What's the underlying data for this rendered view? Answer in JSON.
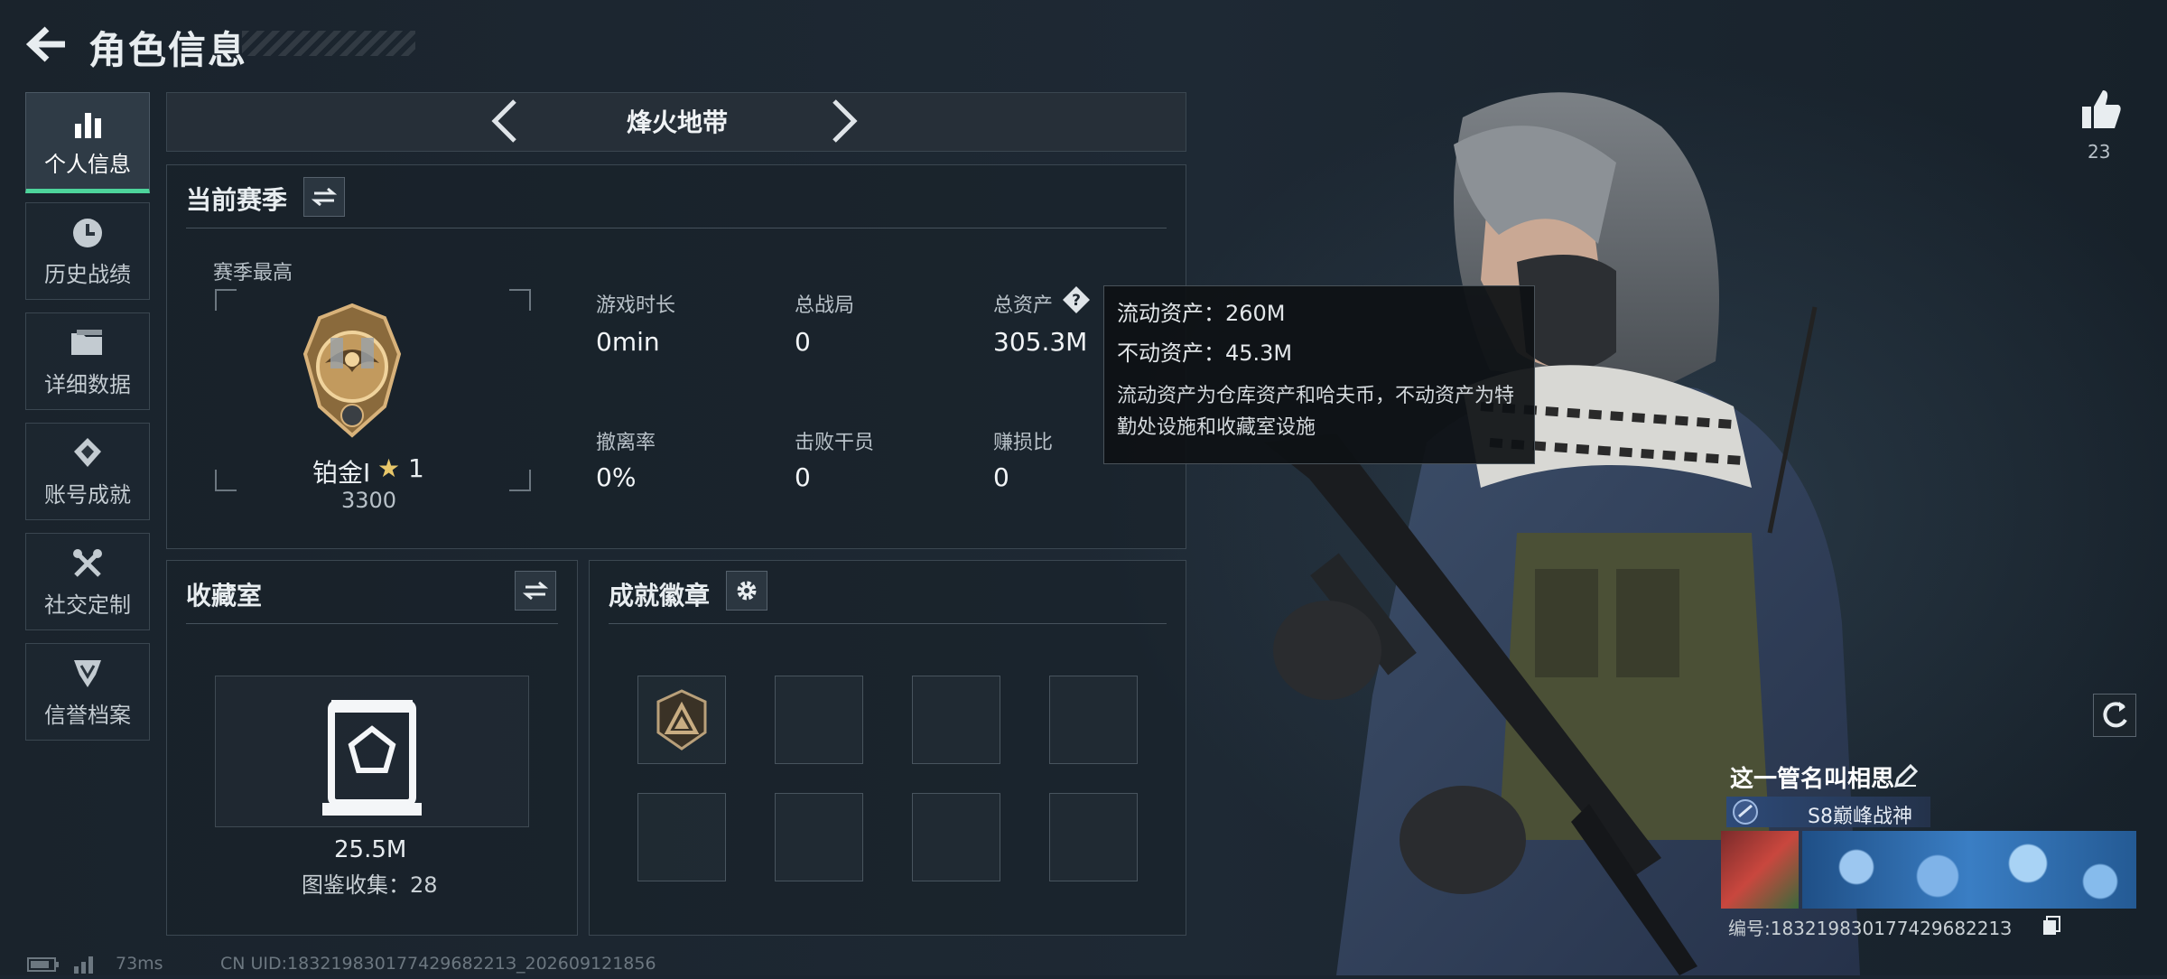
{
  "header": {
    "title": "角色信息"
  },
  "nav": {
    "items": [
      {
        "label": "个人信息",
        "icon": "bar-chart-icon"
      },
      {
        "label": "历史战绩",
        "icon": "clock-icon"
      },
      {
        "label": "详细数据",
        "icon": "folder-icon"
      },
      {
        "label": "账号成就",
        "icon": "achievement-icon"
      },
      {
        "label": "社交定制",
        "icon": "tools-icon"
      },
      {
        "label": "信誉档案",
        "icon": "shield-icon"
      }
    ]
  },
  "mode": {
    "name": "烽火地带"
  },
  "season": {
    "title": "当前赛季",
    "best_label": "赛季最高",
    "rank_name": "铂金Ⅰ",
    "rank_star": "1",
    "rank_score": "3300",
    "stats": [
      {
        "label": "游戏时长",
        "value": "0min"
      },
      {
        "label": "总战局",
        "value": "0"
      },
      {
        "label": "总资产",
        "value": "305.3M"
      },
      {
        "label": "撤离率",
        "value": "0%"
      },
      {
        "label": "击败干员",
        "value": "0"
      },
      {
        "label": "赚损比",
        "value": "0"
      }
    ]
  },
  "tooltip": {
    "liquid": "流动资产：260M",
    "fixed": "不动资产：45.3M",
    "desc": "流动资产为仓库资产和哈夫币，不动资产为特勤处设施和收藏室设施"
  },
  "collection": {
    "title": "收藏室",
    "value": "25.5M",
    "count_text": "图鉴收集：28"
  },
  "badges": {
    "title": "成就徽章"
  },
  "profile": {
    "likes": "23",
    "player_name": "这一管名叫相思",
    "title_badge": "S8巅峰战神",
    "id_text": "编号:18321983017742968221З"
  },
  "footer": {
    "ping": "73ms",
    "uid": "CN UID:18321983017742968221З_202609121856"
  },
  "colors": {
    "accent_green": "#4dd49b",
    "bg": "#1b2530"
  }
}
